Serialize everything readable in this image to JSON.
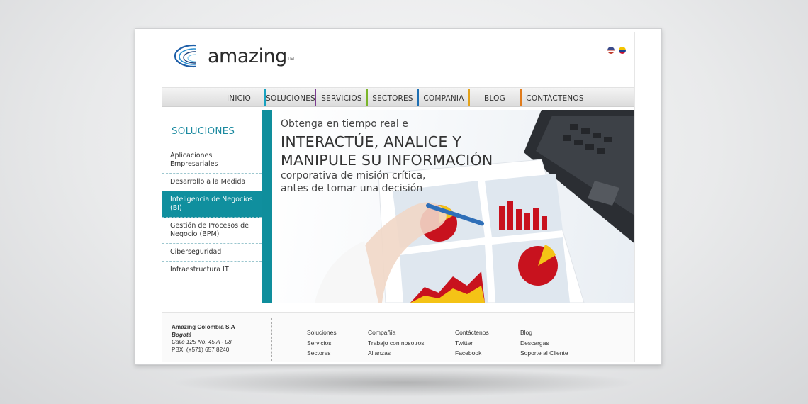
{
  "brand": {
    "name": "amazing",
    "tm": "TM"
  },
  "language_flags": [
    "us-flag-icon",
    "colombia-flag-icon"
  ],
  "nav": [
    {
      "label": "INICIO",
      "color": ""
    },
    {
      "label": "SOLUCIONES",
      "color": "#17a2c0"
    },
    {
      "label": "SERVICIOS",
      "color": "#7a3b8f"
    },
    {
      "label": "SECTORES",
      "color": "#7bb52a"
    },
    {
      "label": "COMPAÑIA",
      "color": "#1d6fb3"
    },
    {
      "label": "BLOG",
      "color": "#e3a21a"
    },
    {
      "label": "CONTÁCTENOS",
      "color": "#e07b1c"
    }
  ],
  "sidebar": {
    "title": "SOLUCIONES",
    "items": [
      {
        "label": "Aplicaciones Empresariales",
        "active": false
      },
      {
        "label": "Desarrollo a la Medida",
        "active": false
      },
      {
        "label": "Inteligencia de Negocios (BI)",
        "active": true
      },
      {
        "label": "Gestión de Procesos de Negocio (BPM)",
        "active": false
      },
      {
        "label": "Ciberseguridad",
        "active": false
      },
      {
        "label": "Infraestructura IT",
        "active": false
      }
    ]
  },
  "hero": {
    "line1": "Obtenga en tiempo real e",
    "line2": "INTERACTÚE, ANALICE Y",
    "line3": "MANIPULE SU INFORMACIÓN",
    "line4": "corporativa de misión crítica,",
    "line5": "antes de tomar una decisión"
  },
  "footer": {
    "company": "Amazing Colombia S.A",
    "city": "Bogotá",
    "address": "Calle 125 No. 45 A - 08",
    "phone": "PBX: (+571) 657 8240",
    "col1": [
      "Soluciones",
      "Servicios",
      "Sectores"
    ],
    "col2": [
      "Compañía",
      "Trabajo con nosotros",
      "Alianzas"
    ],
    "col3": [
      "Contáctenos",
      "Twitter",
      "Facebook"
    ],
    "col4": [
      "Blog",
      "Descargas",
      "Soporte al Cliente"
    ]
  },
  "colors": {
    "accent": "#0f8e9c",
    "title": "#1c8aa0"
  }
}
